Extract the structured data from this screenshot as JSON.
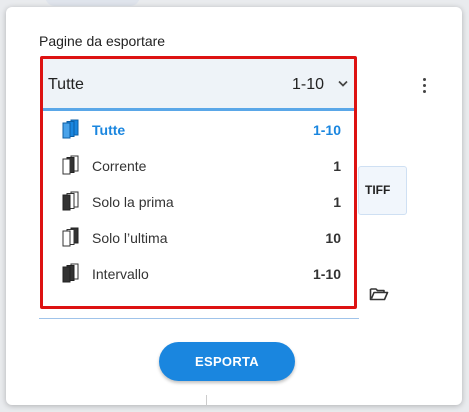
{
  "dialog": {
    "title": "Pagine da esportare",
    "background_button_text": "TIFF",
    "export_label": "ESPORTA"
  },
  "select": {
    "value": "Tutte",
    "range": "1-10",
    "icon": "chevron-down-icon"
  },
  "menu": {
    "items": [
      {
        "label": "Tutte",
        "count": "1-10",
        "icon": "pages-all-icon",
        "selected": true
      },
      {
        "label": "Corrente",
        "count": "1",
        "icon": "page-current-icon",
        "selected": false
      },
      {
        "label": "Solo la prima",
        "count": "1",
        "icon": "page-first-icon",
        "selected": false
      },
      {
        "label": "Solo l’ultima",
        "count": "10",
        "icon": "page-last-icon",
        "selected": false
      },
      {
        "label": "Intervallo",
        "count": "1-10",
        "icon": "page-range-icon",
        "selected": false
      }
    ]
  },
  "colors": {
    "accent": "#1a86df",
    "highlight_border": "#dd1212",
    "select_bg": "#eef3f8"
  }
}
